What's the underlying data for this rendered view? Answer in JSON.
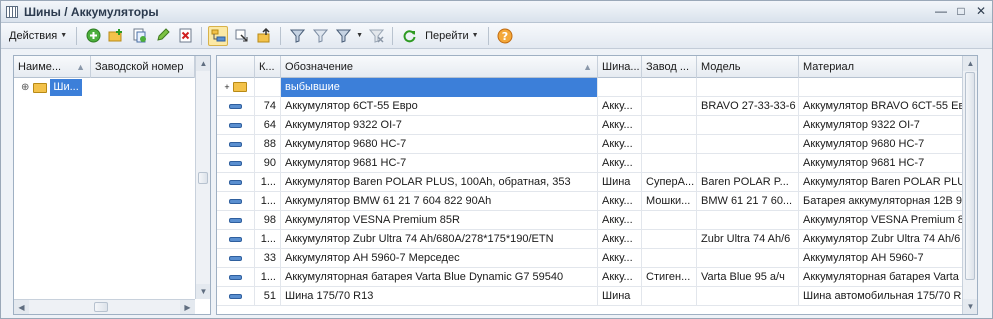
{
  "window": {
    "title": "Шины / Аккумуляторы"
  },
  "toolbar": {
    "actions_label": "Действия",
    "goto_label": "Перейти"
  },
  "left_grid": {
    "headers": [
      "Наиме...",
      "Заводской номер"
    ],
    "rows": [
      {
        "name": "Ши..."
      }
    ]
  },
  "right_grid": {
    "headers": [
      "К...",
      "Обозначение",
      "Шина...",
      "Завод ...",
      "Модель",
      "Материал"
    ],
    "rows": [
      {
        "type": "folder",
        "code": "",
        "designation": "выбывшие",
        "tire": "",
        "factory": "",
        "model": "",
        "material": ""
      },
      {
        "type": "item",
        "code": "74",
        "designation": "Аккумулятор 6СТ-55 Евро",
        "tire": "Акку...",
        "factory": "",
        "model": "BRAVO 27-33-33-6",
        "material": "Аккумулятор BRAVO 6СТ-55 Ев"
      },
      {
        "type": "item",
        "code": "64",
        "designation": "Аккумулятор 9322 OI-7",
        "tire": "Акку...",
        "factory": "",
        "model": "",
        "material": "Аккумулятор 9322 OI-7"
      },
      {
        "type": "item",
        "code": "88",
        "designation": "Аккумулятор 9680 НС-7",
        "tire": "Акку...",
        "factory": "",
        "model": "",
        "material": "Аккумулятор 9680 НС-7"
      },
      {
        "type": "item",
        "code": "90",
        "designation": "Аккумулятор 9681 НС-7",
        "tire": "Акку...",
        "factory": "",
        "model": "",
        "material": "Аккумулятор 9681 НС-7"
      },
      {
        "type": "item",
        "code": "1...",
        "designation": "Аккумулятор Baren POLAR PLUS, 100Ah, обратная, 353",
        "tire": "Шина",
        "factory": "СуперА...",
        "model": "Baren POLAR P...",
        "material": "Аккумулятор Baren POLAR PLU"
      },
      {
        "type": "item",
        "code": "1...",
        "designation": "Аккумулятор BMW 61 21 7 604 822 90Ah",
        "tire": "Акку...",
        "factory": "Мошки...",
        "model": "BMW 61 21 7 60...",
        "material": "Батарея аккумуляторная 12В 9"
      },
      {
        "type": "item",
        "code": "98",
        "designation": "Аккумулятор VESNA Premium 85R",
        "tire": "Акку...",
        "factory": "",
        "model": "",
        "material": "Аккумулятор VESNA Premium 8"
      },
      {
        "type": "item",
        "code": "1...",
        "designation": "Аккумулятор Zubr Ultra 74 Ah/680A/278*175*190/ETN",
        "tire": "Акку...",
        "factory": "",
        "model": "Zubr Ultra 74 Ah/6",
        "material": "Аккумулятор Zubr Ultra 74 Ah/6"
      },
      {
        "type": "item",
        "code": "33",
        "designation": "Аккумулятор АН 5960-7 Мерседес",
        "tire": "Акку...",
        "factory": "",
        "model": "",
        "material": "Аккумулятор АН 5960-7"
      },
      {
        "type": "item",
        "code": "1...",
        "designation": "Аккумуляторная батарея Varta Blue Dynamic G7 59540",
        "tire": "Акку...",
        "factory": "Стиген...",
        "model": "Varta Blue 95 а/ч",
        "material": "Аккумуляторная батарея Varta"
      },
      {
        "type": "item",
        "code": "51",
        "designation": "Шина 175/70 R13",
        "tire": "Шина",
        "factory": "",
        "model": "",
        "material": "Шина автомобильная 175/70 R"
      }
    ]
  }
}
